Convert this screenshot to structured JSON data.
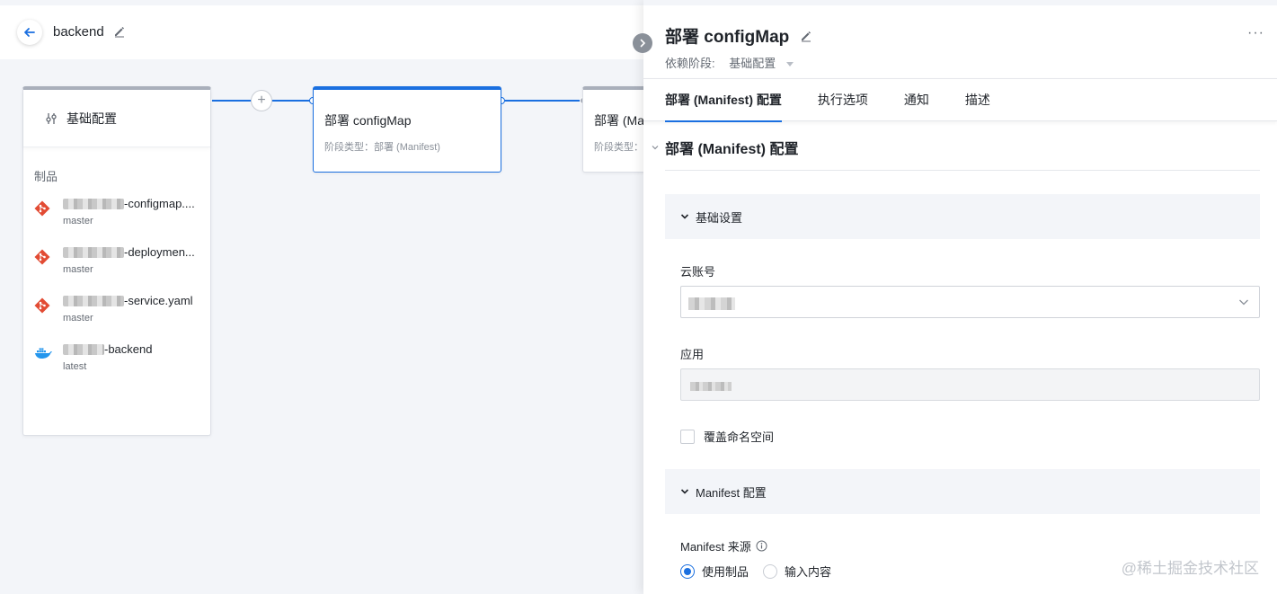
{
  "header": {
    "title": "backend"
  },
  "canvas": {
    "base_stage": {
      "title": "基础配置",
      "section_label": "制品",
      "artifacts": [
        {
          "name": "-configmap....",
          "ref": "master",
          "icon": "git-icon"
        },
        {
          "name": "-deploymen...",
          "ref": "master",
          "icon": "git-icon"
        },
        {
          "name": "-service.yaml",
          "ref": "master",
          "icon": "git-icon"
        },
        {
          "name": "-backend",
          "ref": "latest",
          "icon": "docker-icon"
        }
      ]
    },
    "deploy_stage": {
      "title": "部署 configMap",
      "subtitle": "阶段类型：部署 (Manifest)"
    },
    "next_stage": {
      "title": "部署 (Ma",
      "subtitle": "阶段类型："
    },
    "plus": "+"
  },
  "drawer": {
    "title": "部署 configMap",
    "more": "···",
    "depends_label": "依赖阶段:",
    "depends_value": "基础配置",
    "tabs": [
      {
        "label": "部署 (Manifest) 配置",
        "active": true
      },
      {
        "label": "执行选项",
        "active": false
      },
      {
        "label": "通知",
        "active": false
      },
      {
        "label": "描述",
        "active": false
      }
    ],
    "section_title": "部署 (Manifest) 配置",
    "group_basic": "基础设置",
    "cloud_account_label": "云账号",
    "app_label": "应用",
    "override_ns_label": "覆盖命名空间",
    "group_manifest": "Manifest 配置",
    "manifest_source_label": "Manifest 来源",
    "radio_use_artifact": "使用制品",
    "radio_input_content": "输入内容"
  },
  "watermark": "@稀土掘金技术社区",
  "colors": {
    "accent": "#1a6fe0",
    "git_red": "#e24b33",
    "docker_blue": "#2496ed"
  }
}
